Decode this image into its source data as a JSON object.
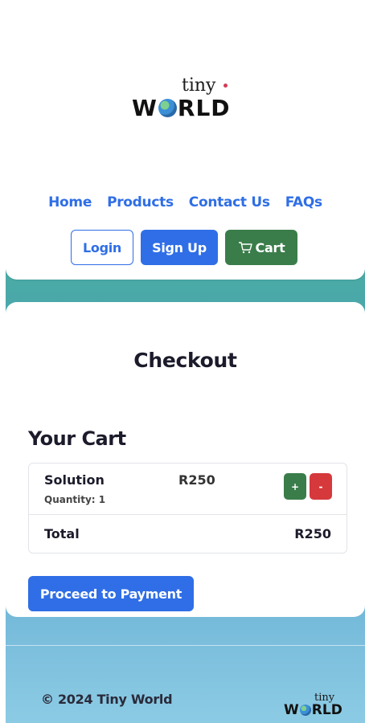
{
  "brand": {
    "logo_top": "tiny",
    "logo_w": "W",
    "logo_rest": "RLD",
    "colors": {
      "primary": "#2f6ee6",
      "success": "#3a7d4a",
      "danger": "#d6393c"
    }
  },
  "nav": {
    "items": [
      "Home",
      "Products",
      "Contact Us",
      "FAQs"
    ]
  },
  "auth": {
    "login_label": "Login",
    "signup_label": "Sign Up",
    "cart_label": "Cart",
    "cart_icon": "cart-icon"
  },
  "checkout": {
    "title": "Checkout",
    "cart_heading": "Your Cart",
    "items": [
      {
        "name": "Solution",
        "quantity": "Quantity: 1",
        "price": "R250",
        "plus": "+",
        "minus": "-"
      }
    ],
    "total_label": "Total",
    "total_value": "R250",
    "pay_label": "Proceed to Payment"
  },
  "footer": {
    "copyright": "© 2024 Tiny World",
    "logo_top": "tiny",
    "logo_w": "W",
    "logo_rest": "RLD"
  }
}
